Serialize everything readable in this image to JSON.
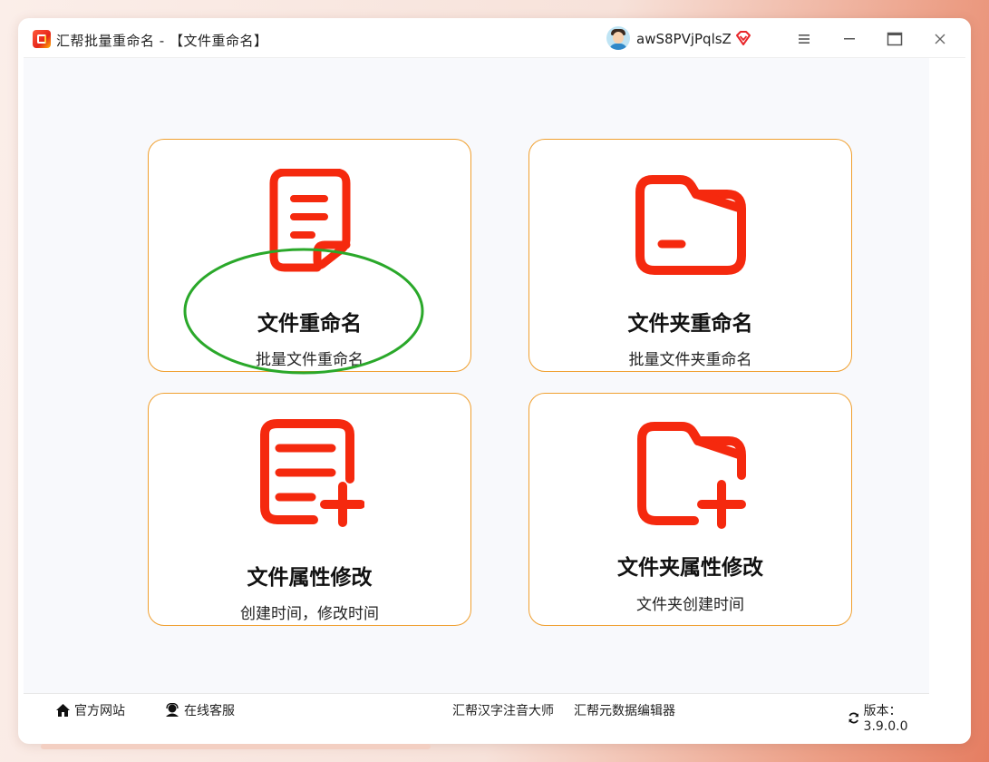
{
  "window": {
    "title": "汇帮批量重命名 - 【文件重命名】",
    "username": "awS8PVjPqlsZ"
  },
  "colors": {
    "accent": "#f5290e",
    "card_border": "#f0a030",
    "highlight": "#2aa82a"
  },
  "cards": [
    {
      "title": "文件重命名",
      "subtitle": "批量文件重命名",
      "icon": "document-icon"
    },
    {
      "title": "文件夹重命名",
      "subtitle": "批量文件夹重命名",
      "icon": "folder-icon"
    },
    {
      "title": "文件属性修改",
      "subtitle": "创建时间，修改时间",
      "icon": "document-add-icon"
    },
    {
      "title": "文件夹属性修改",
      "subtitle": "文件夹创建时间",
      "icon": "folder-add-icon"
    }
  ],
  "footer": {
    "official_site": "官方网站",
    "online_service": "在线客服",
    "pinyin_tool": "汇帮汉字注音大师",
    "metadata_tool": "汇帮元数据编辑器",
    "version": "版本：3.9.0.0"
  }
}
